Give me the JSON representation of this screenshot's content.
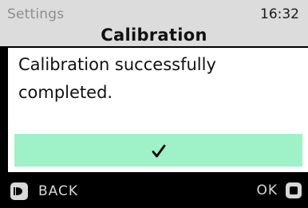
{
  "header": {
    "section": "Settings",
    "time": "16:32",
    "title": "Calibration"
  },
  "dialog": {
    "message": "Calibration successfully completed.",
    "confirm_icon": "checkmark-icon",
    "confirm_color": "#9ff2c8"
  },
  "footer": {
    "back_label": "BACK",
    "back_icon": "back-button-icon",
    "ok_label": "OK",
    "ok_icon": "ok-button-icon"
  },
  "colors": {
    "header_bg": "#dcdcdc",
    "card_bg": "#ffffff",
    "footer_bg": "#000000"
  }
}
